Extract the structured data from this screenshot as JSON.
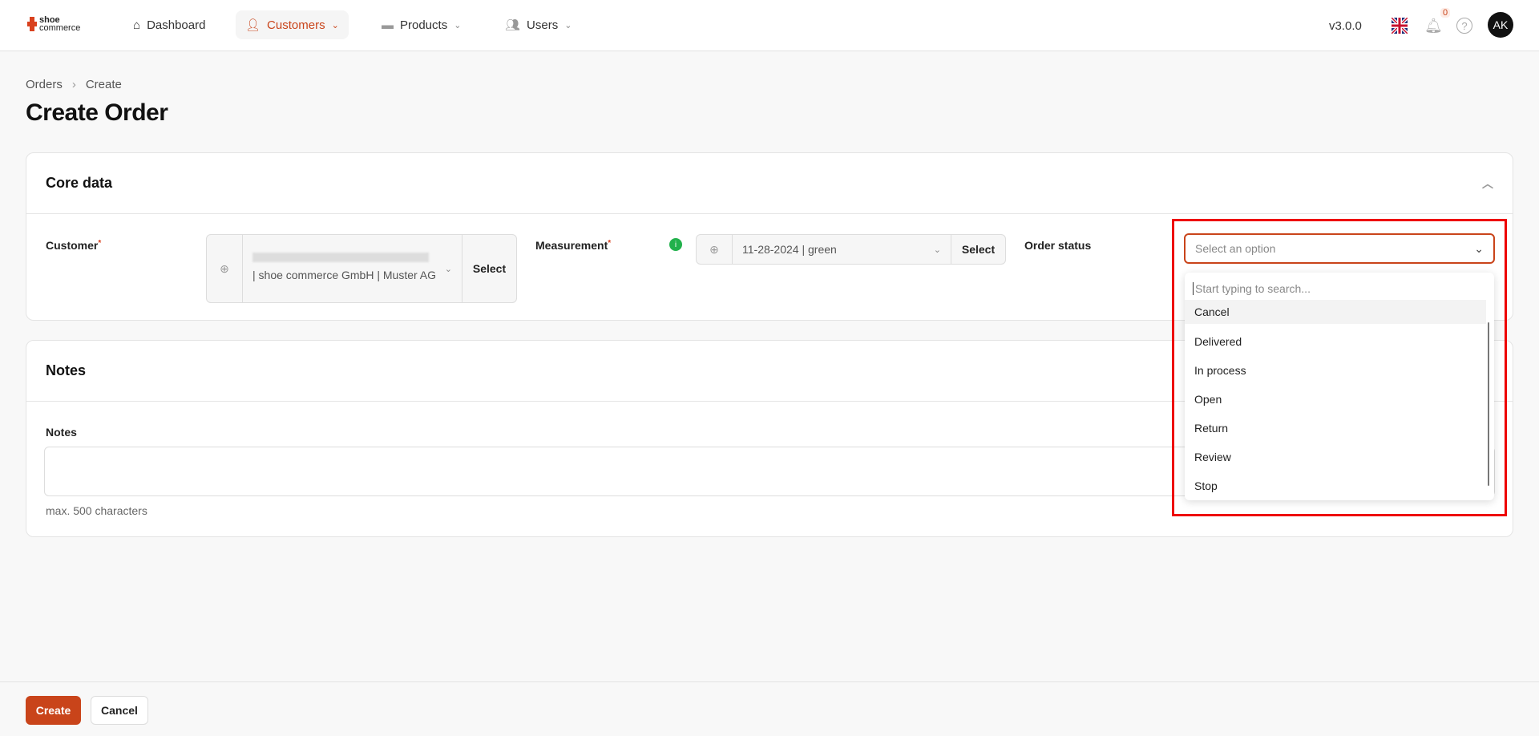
{
  "header": {
    "logo": "shoe commerce",
    "nav": [
      {
        "label": "Dashboard"
      },
      {
        "label": "Customers"
      },
      {
        "label": "Products"
      },
      {
        "label": "Users"
      }
    ],
    "version": "v3.0.0",
    "notification_count": "0",
    "avatar": "AK"
  },
  "breadcrumb": [
    "Orders",
    "Create"
  ],
  "page_title": "Create Order",
  "core": {
    "title": "Core data",
    "customer_label": "Customer",
    "customer_value": "| shoe commerce GmbH | Muster AG",
    "select": "Select",
    "measurement_label": "Measurement",
    "measurement_value": "11-28-2024 | green",
    "order_status_label": "Order status",
    "order_status_placeholder": "Select an option"
  },
  "dropdown": {
    "search_placeholder": "Start typing to search...",
    "options": [
      "Cancel",
      "Delivered",
      "In process",
      "Open",
      "Return",
      "Review",
      "Stop"
    ]
  },
  "notes": {
    "title": "Notes",
    "label": "Notes",
    "hint": "max. 500 characters"
  },
  "footer": {
    "create": "Create",
    "cancel": "Cancel"
  },
  "colors": {
    "accent": "#c9441a",
    "highlight": "#ee0000"
  }
}
